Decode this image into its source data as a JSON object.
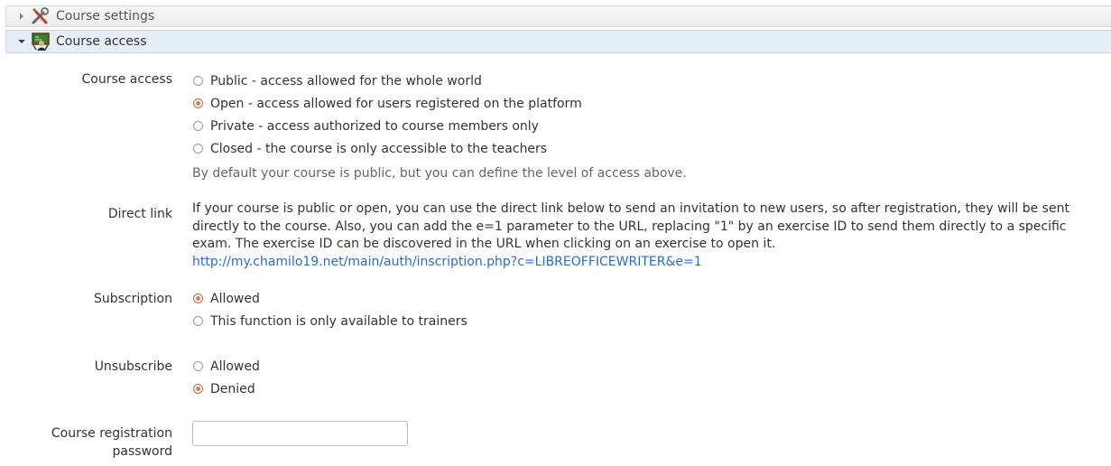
{
  "panels": {
    "settings": {
      "title": "Course settings"
    },
    "access": {
      "title": "Course access"
    }
  },
  "course_access": {
    "label": "Course access",
    "options": [
      {
        "text": "Public - access allowed for the whole world",
        "checked": false
      },
      {
        "text": "Open - access allowed for users registered on the platform",
        "checked": true
      },
      {
        "text": "Private - access authorized to course members only",
        "checked": false
      },
      {
        "text": "Closed - the course is only accessible to the teachers",
        "checked": false
      }
    ],
    "help": "By default your course is public, but you can define the level of access above."
  },
  "direct_link": {
    "label": "Direct link",
    "description": "If your course is public or open, you can use the direct link below to send an invitation to new users, so after registration, they will be sent directly to the course. Also, you can add the e=1 parameter to the URL, replacing \"1\" by an exercise ID to send them directly to a specific exam. The exercise ID can be discovered in the URL when clicking on an exercise to open it.",
    "url": "http://my.chamilo19.net/main/auth/inscription.php?c=LIBREOFFICEWRITER&e=1"
  },
  "subscription": {
    "label": "Subscription",
    "options": [
      {
        "text": "Allowed",
        "checked": true
      },
      {
        "text": "This function is only available to trainers",
        "checked": false
      }
    ]
  },
  "unsubscribe": {
    "label": "Unsubscribe",
    "options": [
      {
        "text": "Allowed",
        "checked": false
      },
      {
        "text": "Denied",
        "checked": true
      }
    ]
  },
  "registration_password": {
    "label_line1": "Course registration",
    "label_line2": "password",
    "value": ""
  },
  "colors": {
    "accent": "#e8784f",
    "link": "#2a6ad4",
    "panel_active": "#e6eef7"
  }
}
